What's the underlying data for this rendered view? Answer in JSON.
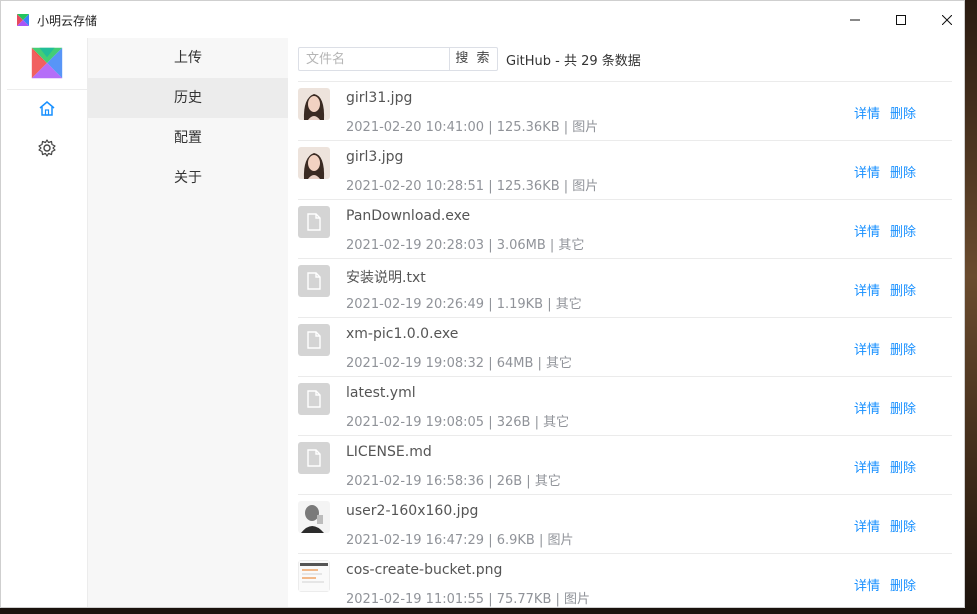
{
  "app": {
    "title": "小明云存储"
  },
  "menu": [
    {
      "label": "上传"
    },
    {
      "label": "历史"
    },
    {
      "label": "配置"
    },
    {
      "label": "关于"
    }
  ],
  "search": {
    "placeholder": "文件名",
    "button": "搜 索",
    "summary": "GitHub - 共 29 条数据"
  },
  "actions": {
    "detail": "详情",
    "delete": "删除"
  },
  "files": [
    {
      "name": "girl31.jpg",
      "meta": "2021-02-20 10:41:00 | 125.36KB | 图片",
      "thumb": "photo-girl"
    },
    {
      "name": "girl3.jpg",
      "meta": "2021-02-20 10:28:51 | 125.36KB | 图片",
      "thumb": "photo-girl"
    },
    {
      "name": "PanDownload.exe",
      "meta": "2021-02-19 20:28:03 | 3.06MB | 其它",
      "thumb": "file-icon"
    },
    {
      "name": "安装说明.txt",
      "meta": "2021-02-19 20:26:49 | 1.19KB | 其它",
      "thumb": "file-icon"
    },
    {
      "name": "xm-pic1.0.0.exe",
      "meta": "2021-02-19 19:08:32 | 64MB | 其它",
      "thumb": "file-icon"
    },
    {
      "name": "latest.yml",
      "meta": "2021-02-19 19:08:05 | 326B | 其它",
      "thumb": "file-icon"
    },
    {
      "name": "LICENSE.md",
      "meta": "2021-02-19 16:58:36 | 26B | 其它",
      "thumb": "file-icon"
    },
    {
      "name": "user2-160x160.jpg",
      "meta": "2021-02-19 16:47:29 | 6.9KB | 图片",
      "thumb": "photo-user"
    },
    {
      "name": "cos-create-bucket.png",
      "meta": "2021-02-19 11:01:55 | 75.77KB | 图片",
      "thumb": "photo-screenshot"
    }
  ],
  "colors": {
    "link": "#1890ff",
    "menu_bg": "#f7f7f7",
    "menu_active": "#ececec"
  }
}
